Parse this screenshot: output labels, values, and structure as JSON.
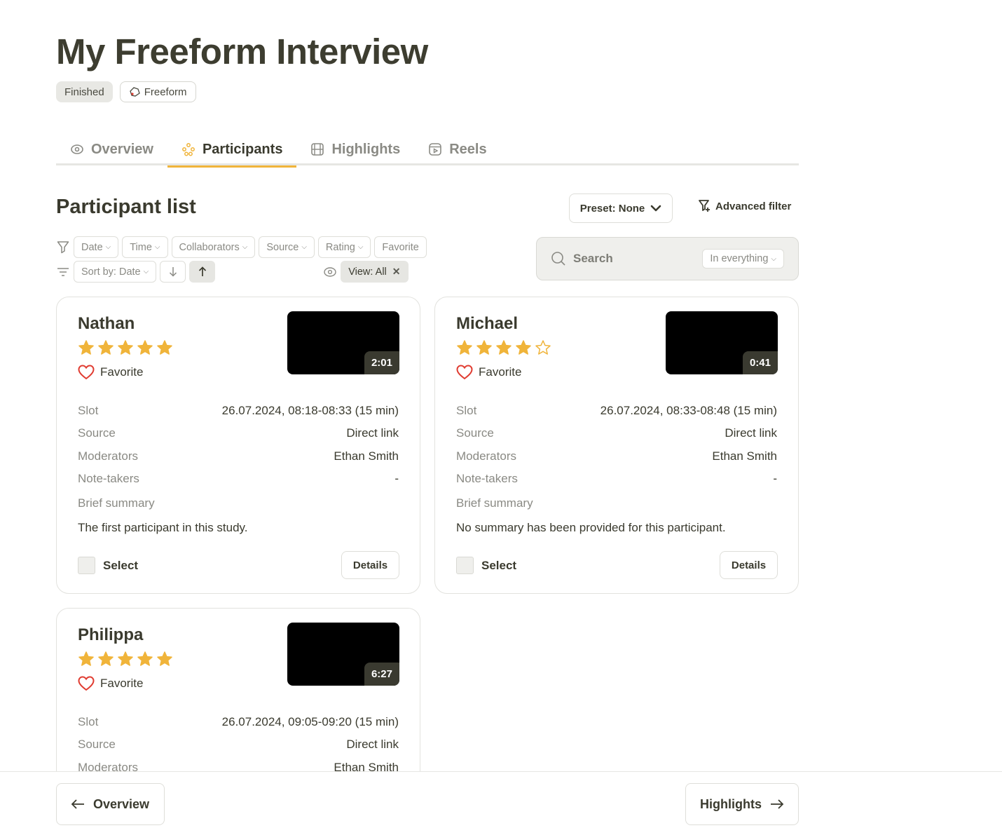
{
  "page": {
    "title": "My Freeform Interview"
  },
  "badges": {
    "status": "Finished",
    "type": "Freeform"
  },
  "tabs": [
    {
      "label": "Overview",
      "icon": "eye-icon"
    },
    {
      "label": "Participants",
      "icon": "participants-icon",
      "active": true
    },
    {
      "label": "Highlights",
      "icon": "film-icon"
    },
    {
      "label": "Reels",
      "icon": "reels-icon"
    }
  ],
  "section": {
    "title": "Participant list"
  },
  "preset": {
    "label": "Preset: None"
  },
  "advanced_filter": {
    "label": "Advanced filter"
  },
  "filters": {
    "date": "Date",
    "time": "Time",
    "collaborators": "Collaborators",
    "source": "Source",
    "rating": "Rating",
    "favorite": "Favorite"
  },
  "sort": {
    "label": "Sort by: Date"
  },
  "view": {
    "label": "View: All"
  },
  "search": {
    "label": "Search",
    "scope": "In everything"
  },
  "labels": {
    "slot": "Slot",
    "source": "Source",
    "moderators": "Moderators",
    "note_takers": "Note-takers",
    "brief_summary": "Brief summary",
    "favorite": "Favorite",
    "select": "Select",
    "details": "Details"
  },
  "participants": [
    {
      "name": "Nathan",
      "rating": 5,
      "duration": "2:01",
      "slot": "26.07.2024, 08:18-08:33 (15 min)",
      "source": "Direct link",
      "moderators": "Ethan Smith",
      "note_takers": "-",
      "summary": "The first participant in this study."
    },
    {
      "name": "Michael",
      "rating": 4,
      "duration": "0:41",
      "slot": "26.07.2024, 08:33-08:48 (15 min)",
      "source": "Direct link",
      "moderators": "Ethan Smith",
      "note_takers": "-",
      "summary": "No summary has been provided for this participant."
    },
    {
      "name": "Philippa",
      "rating": 5,
      "duration": "6:27",
      "slot": "26.07.2024, 09:05-09:20 (15 min)",
      "source": "Direct link",
      "moderators": "Ethan Smith"
    }
  ],
  "footer": {
    "prev_label": "Overview",
    "next_label": "Highlights"
  },
  "colors": {
    "accent": "#f0b43a",
    "star": "#f0b43a",
    "heart": "#e03c31",
    "text": "#3a3a2e"
  }
}
